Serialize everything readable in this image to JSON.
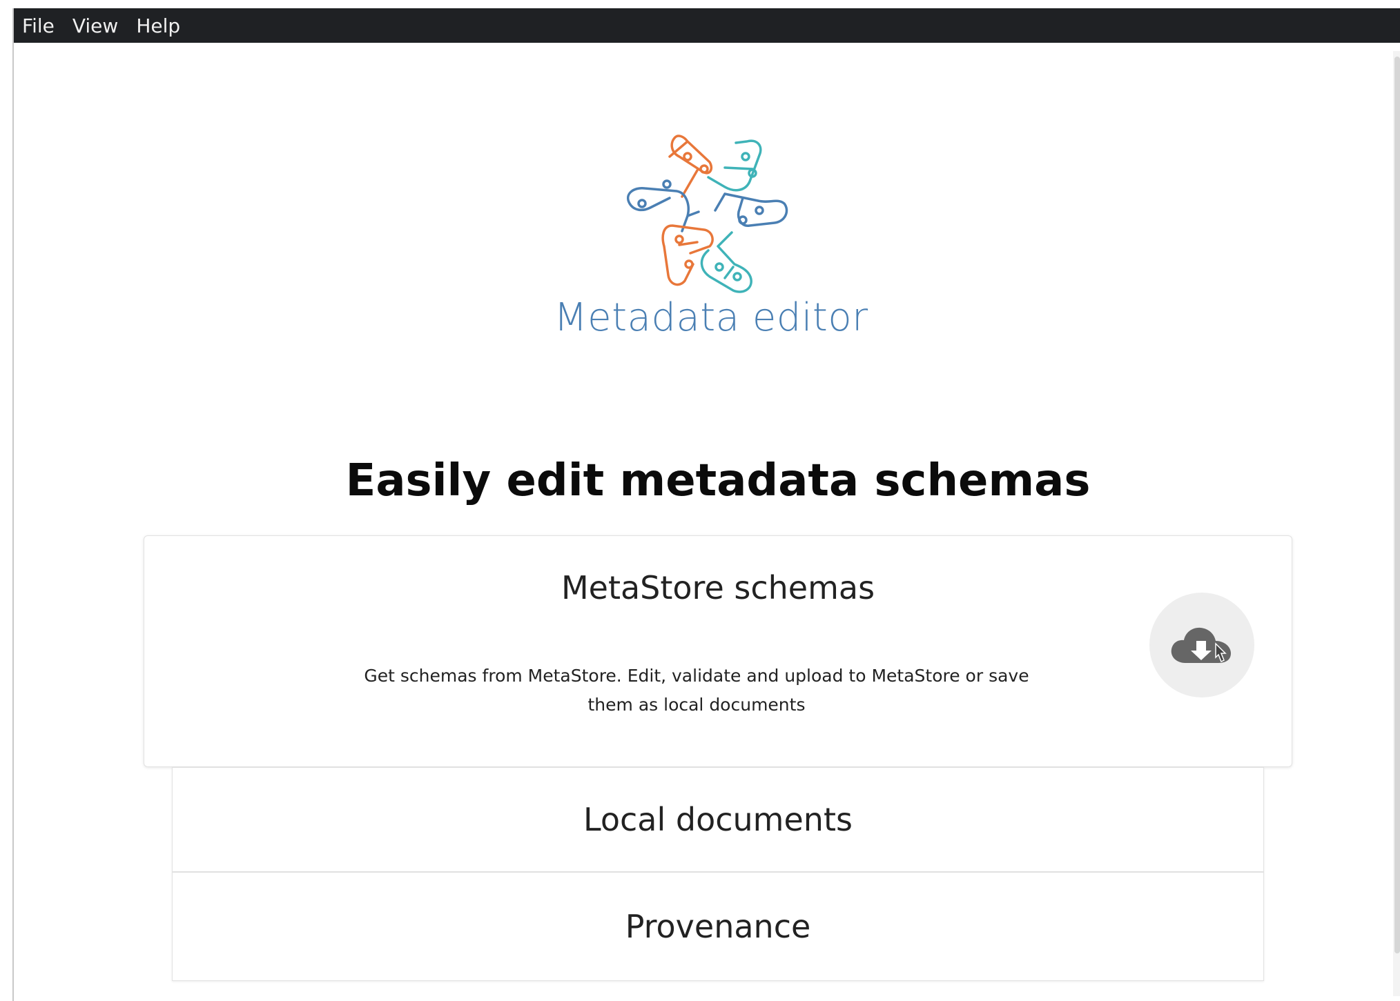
{
  "menubar": {
    "items": [
      "File",
      "View",
      "Help"
    ]
  },
  "logo": {
    "text": "Metadata editor",
    "colors": [
      "#e8773a",
      "#4a7fb3",
      "#3fb3b8"
    ]
  },
  "headline": "Easily edit metadata schemas",
  "cards": {
    "metastore": {
      "title": "MetaStore schemas",
      "description": "Get schemas from MetaStore. Edit, validate and upload to MetaStore or save them as local documents",
      "action_icon": "cloud-download-icon"
    },
    "local": {
      "title": "Local documents"
    },
    "provenance": {
      "title": "Provenance"
    }
  }
}
